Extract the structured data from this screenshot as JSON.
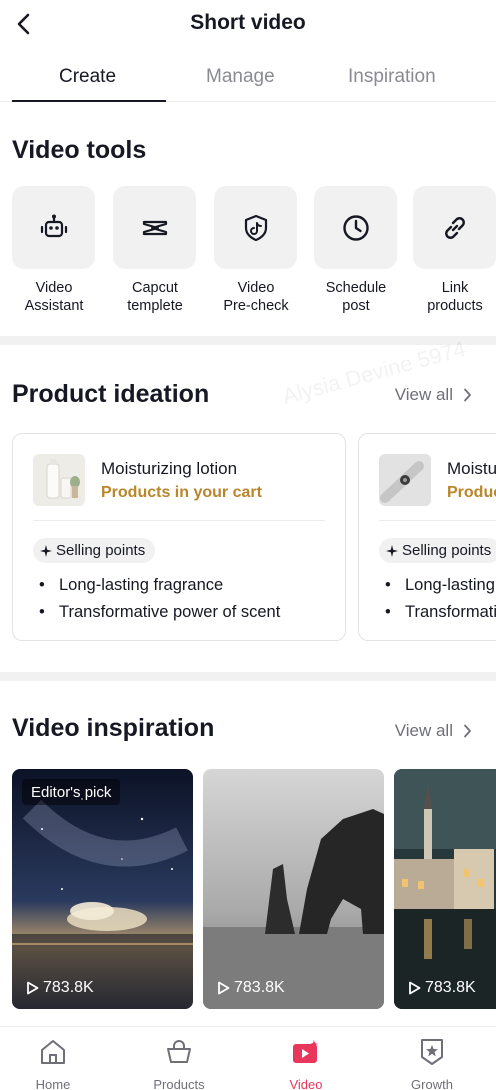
{
  "header": {
    "title": "Short video"
  },
  "tabs": [
    {
      "label": "Create"
    },
    {
      "label": "Manage"
    },
    {
      "label": "Inspiration"
    }
  ],
  "video_tools": {
    "title": "Video tools",
    "items": [
      {
        "line1": "Video",
        "line2": "Assistant",
        "icon": "robot-icon"
      },
      {
        "line1": "Capcut",
        "line2": "templete",
        "icon": "capcut-icon"
      },
      {
        "line1": "Video",
        "line2": "Pre-check",
        "icon": "shield-tiktok-icon"
      },
      {
        "line1": "Schedule",
        "line2": "post",
        "icon": "clock-icon"
      },
      {
        "line1": "Link",
        "line2": "products",
        "icon": "link-icon"
      }
    ]
  },
  "product_ideation": {
    "title": "Product ideation",
    "view_all": "View all",
    "cards": [
      {
        "name": "Moisturizing lotion",
        "subtitle": "Products in your cart",
        "badge": "Selling points",
        "points": [
          "Long-lasting fragrance",
          "Transformative power of scent"
        ]
      },
      {
        "name": "Moisturizing lotion",
        "subtitle": "Products in your cart",
        "badge": "Selling points",
        "points": [
          "Long-lasting fragrance",
          "Transformative power of scent"
        ]
      }
    ]
  },
  "video_inspiration": {
    "title": "Video inspiration",
    "view_all": "View all",
    "videos": [
      {
        "badge": "Editor's pick",
        "views": "783.8K"
      },
      {
        "views": "783.8K"
      },
      {
        "views": "783.8K"
      }
    ]
  },
  "bottom_nav": [
    {
      "label": "Home",
      "icon": "home-icon"
    },
    {
      "label": "Products",
      "icon": "shopping-bag-icon"
    },
    {
      "label": "Video",
      "icon": "video-icon",
      "active": true
    },
    {
      "label": "Growth",
      "icon": "growth-badge-icon"
    }
  ],
  "watermark": "Alysia Devine 5974",
  "colors": {
    "accent": "#e8375a",
    "highlight": "#b8862b",
    "text": "#161823",
    "muted": "#8a8b91"
  }
}
